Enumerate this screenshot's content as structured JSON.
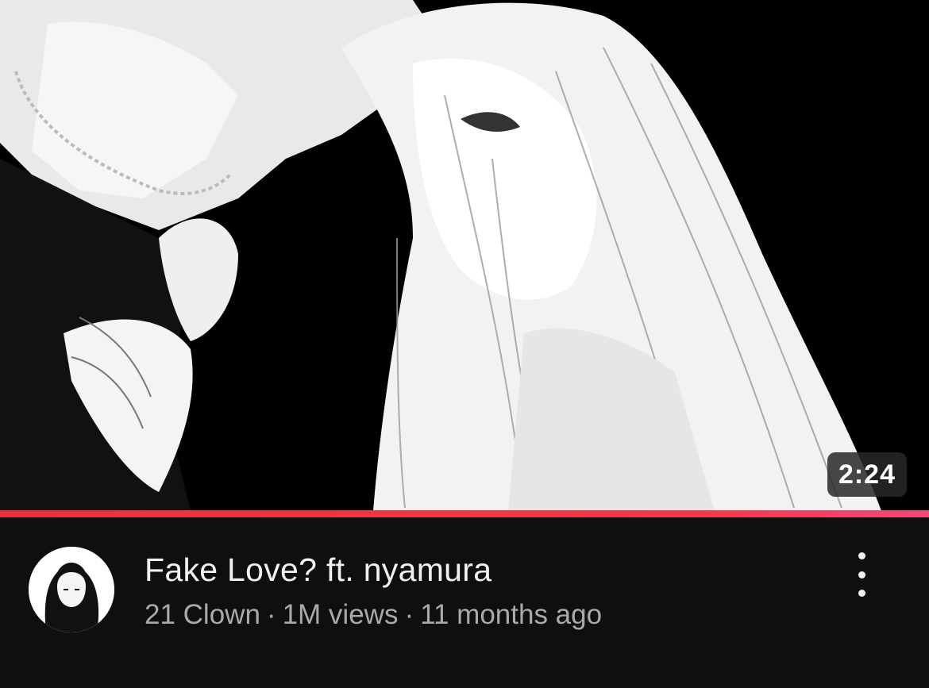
{
  "video": {
    "title": "Fake Love? ft. nyamura",
    "duration": "2:24",
    "channel": "21 Clown",
    "views": "1M views",
    "age": "11 months ago",
    "separator": "·",
    "watch_progress": 1.0
  },
  "icons": {
    "more": "more-vert-icon"
  },
  "colors": {
    "background": "#0f0f0f",
    "progress": "#e8323a",
    "title": "#f1f1f1",
    "subtext": "#aaaaaa"
  }
}
